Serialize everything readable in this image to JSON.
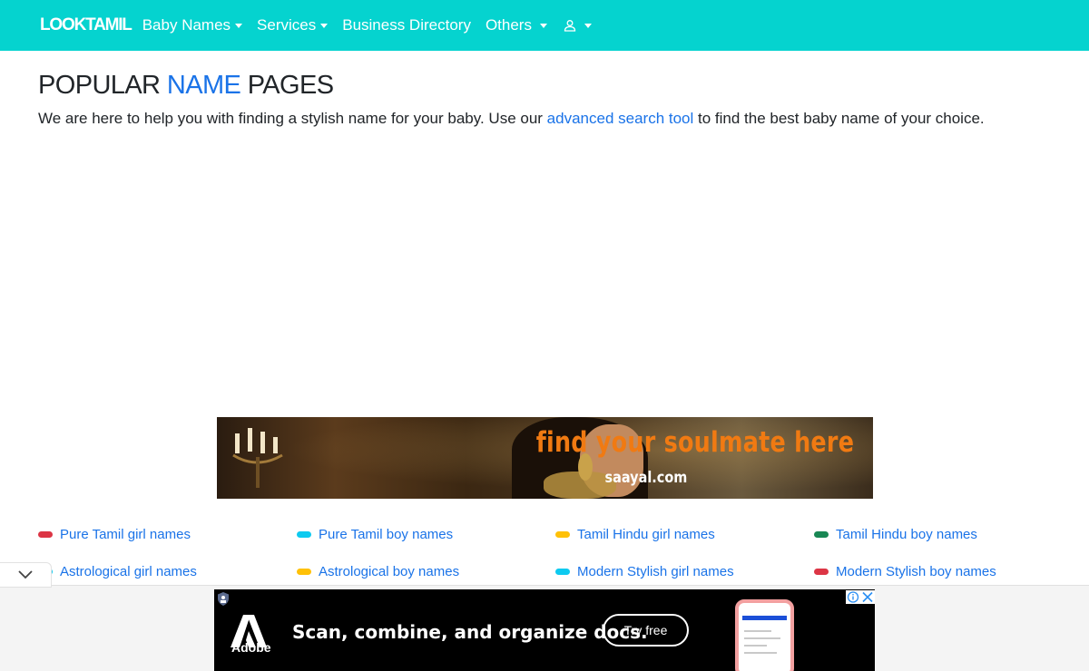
{
  "navbar": {
    "brand": "LOOKTAMIL",
    "items": [
      {
        "label": "Baby Names",
        "dropdown": true
      },
      {
        "label": "Services",
        "dropdown": true
      },
      {
        "label": "Business Directory",
        "dropdown": false
      },
      {
        "label": "Others",
        "dropdown": true
      }
    ],
    "user_icon": "user-icon",
    "bg_color": "#05d3cf"
  },
  "page": {
    "title_prefix": "POPULAR ",
    "title_highlight": "NAME",
    "title_suffix": " PAGES",
    "intro_before": "We are here to help you with finding a stylish name for your baby. Use our ",
    "intro_link": "advanced search tool",
    "intro_after": " to find the best baby name of your choice."
  },
  "banner": {
    "tagline": "find your soulmate here",
    "site": "saayal.com"
  },
  "name_links": [
    {
      "label": "Pure Tamil girl names",
      "color": "#dc3545"
    },
    {
      "label": "Pure Tamil boy names",
      "color": "#0dcaf0"
    },
    {
      "label": "Tamil Hindu girl names",
      "color": "#ffc107"
    },
    {
      "label": "Tamil Hindu boy names",
      "color": "#198754"
    },
    {
      "label": "Astrological girl names",
      "color": "#0dcaf0"
    },
    {
      "label": "Astrological boy names",
      "color": "#ffc107"
    },
    {
      "label": "Modern Stylish girl names",
      "color": "#0dcaf0"
    },
    {
      "label": "Modern Stylish boy names",
      "color": "#dc3545"
    }
  ],
  "ad": {
    "brand": "Adobe",
    "headline": "Scan, combine, and organize docs.",
    "cta": "Try free"
  },
  "colors": {
    "link": "#1a73e8",
    "banner_tagline": "#f07a12"
  }
}
